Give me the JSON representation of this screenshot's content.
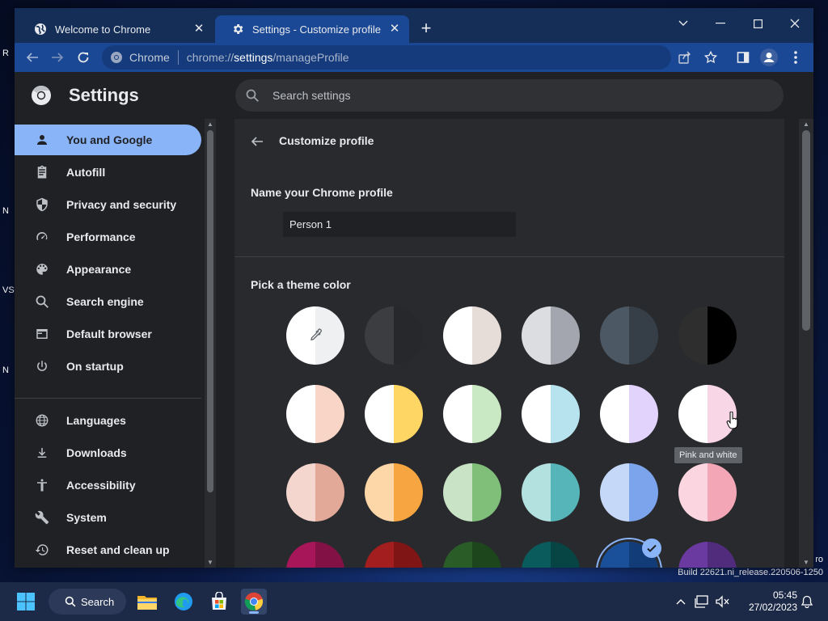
{
  "desktop": {
    "build": "Build 22621.ni_release.220506-1250",
    "fragments": [
      "R",
      "N",
      "VS",
      "N",
      "ro"
    ]
  },
  "tabs": [
    {
      "title": "Welcome to Chrome",
      "icon": "globe-icon",
      "active": false
    },
    {
      "title": "Settings - Customize profile",
      "icon": "gear-icon",
      "active": true
    }
  ],
  "omnibox": {
    "site_label": "Chrome",
    "url_scheme": "chrome://",
    "url_host": "settings",
    "url_path": "/manageProfile"
  },
  "settings": {
    "title": "Settings",
    "search_placeholder": "Search settings"
  },
  "sidebar": {
    "items": [
      {
        "label": "You and Google",
        "icon": "person-icon",
        "active": true
      },
      {
        "label": "Autofill",
        "icon": "clipboard-icon"
      },
      {
        "label": "Privacy and security",
        "icon": "shield-icon"
      },
      {
        "label": "Performance",
        "icon": "speedometer-icon"
      },
      {
        "label": "Appearance",
        "icon": "palette-icon"
      },
      {
        "label": "Search engine",
        "icon": "search-icon"
      },
      {
        "label": "Default browser",
        "icon": "browser-icon"
      },
      {
        "label": "On startup",
        "icon": "power-icon"
      },
      {
        "label": "Languages",
        "icon": "globe-icon"
      },
      {
        "label": "Downloads",
        "icon": "download-icon"
      },
      {
        "label": "Accessibility",
        "icon": "accessibility-icon"
      },
      {
        "label": "System",
        "icon": "wrench-icon"
      },
      {
        "label": "Reset and clean up",
        "icon": "history-icon"
      }
    ]
  },
  "main": {
    "page_title": "Customize profile",
    "name_label": "Name your Chrome profile",
    "profile_name": "Person 1",
    "theme_label": "Pick a theme color",
    "tooltip": "Pink and white",
    "colors": {
      "accent": "#8ab4f8",
      "swatches": [
        [
          "#ffffff",
          "#eef0f2"
        ],
        [
          "#3c3d40",
          "#27282b"
        ],
        [
          "#ffffff",
          "#e6dcd8"
        ],
        [
          "#dcdde0",
          "#a3a6ae"
        ],
        [
          "#4c5864",
          "#363f47"
        ],
        [
          "#2e2e2e",
          "#000000"
        ],
        [
          "#ffffff",
          "#f8d5c6"
        ],
        [
          "#ffffff",
          "#fdd663"
        ],
        [
          "#ffffff",
          "#c9e8c4"
        ],
        [
          "#ffffff",
          "#b6e3ee"
        ],
        [
          "#ffffff",
          "#e2d3fc"
        ],
        [
          "#ffffff",
          "#f9d6e5"
        ],
        [
          "#f5d6cf",
          "#e2a898"
        ],
        [
          "#fdd7a7",
          "#f7a541"
        ],
        [
          "#c8e3c5",
          "#7fbf7a"
        ],
        [
          "#b2e1e0",
          "#56b5b8"
        ],
        [
          "#c6d8f8",
          "#7ba4ec"
        ],
        [
          "#fbd6e0",
          "#f3a7b6"
        ],
        [
          "#a8165a",
          "#821245"
        ],
        [
          "#a31f1f",
          "#7f1515"
        ],
        [
          "#2a5c28",
          "#1d461c"
        ],
        [
          "#0a5c5c",
          "#074444"
        ],
        [
          "#1a4f9a",
          "#123c78"
        ],
        [
          "#6b3aa0",
          "#512b7c"
        ]
      ],
      "selected_index": 22
    }
  },
  "taskbar": {
    "search_label": "Search",
    "time": "05:45",
    "date": "27/02/2023"
  }
}
